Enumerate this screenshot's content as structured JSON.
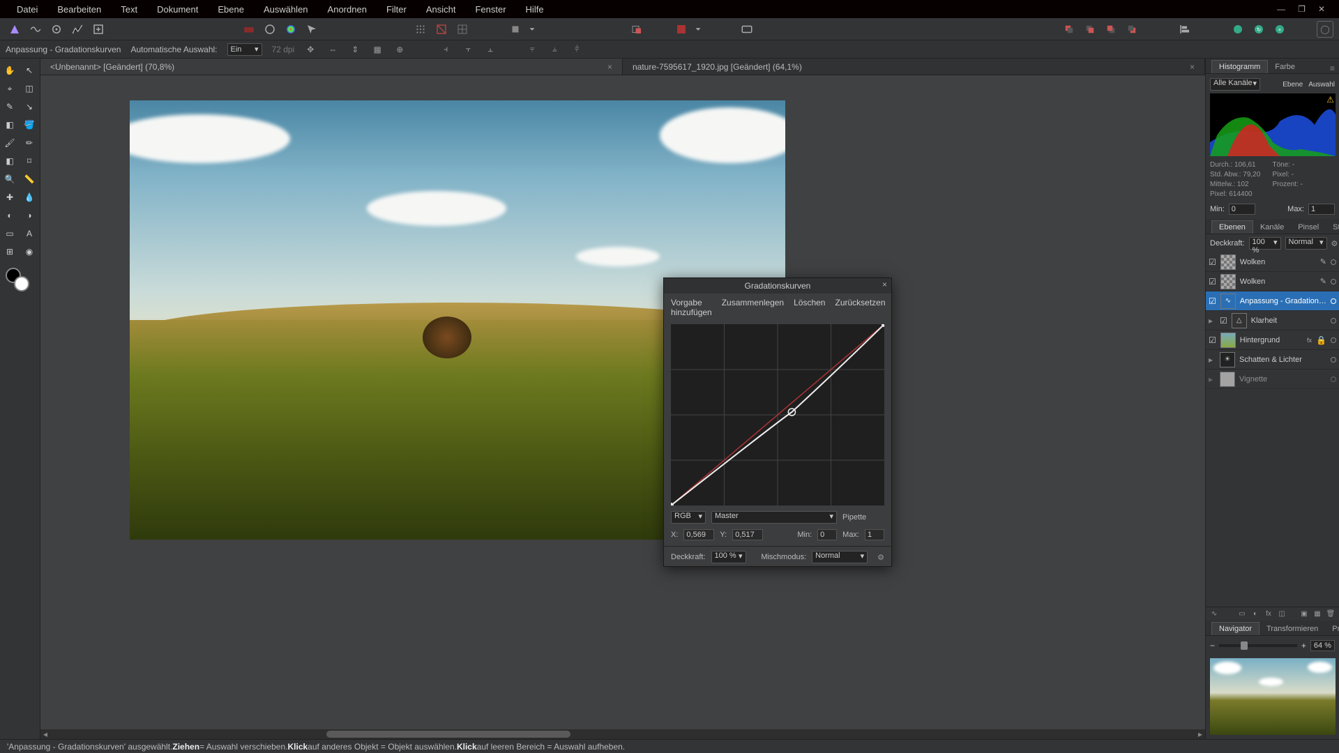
{
  "menu": [
    "Datei",
    "Bearbeiten",
    "Text",
    "Dokument",
    "Ebene",
    "Auswählen",
    "Anordnen",
    "Filter",
    "Ansicht",
    "Fenster",
    "Hilfe"
  ],
  "context": {
    "title": "Anpassung - Gradationskurven",
    "auto_label": "Automatische Auswahl:",
    "auto_value": "Ein",
    "dpi": "72 dpi"
  },
  "tabs": [
    {
      "label": "<Unbenannt> [Geändert] (70,8%)",
      "active": true
    },
    {
      "label": "nature-7595617_1920.jpg [Geändert] (64,1%)",
      "active": false
    }
  ],
  "histogram": {
    "tabs": [
      "Histogramm",
      "Farbe"
    ],
    "channel": "Alle Kanäle",
    "btn1": "Ebene",
    "btn2": "Auswahl",
    "stats": {
      "durch": "Durch.: 106,61",
      "tone": "Töne: -",
      "std": "Std. Abw.: 79,20",
      "pixel_s": "Pixel: -",
      "mittel": "Mittelw.: 102",
      "prozent": "Prozent: -",
      "pixel": "Pixel: 614400"
    },
    "min_label": "Min:",
    "min": "0",
    "max_label": "Max:",
    "max": "1"
  },
  "layers": {
    "tabs": [
      "Ebenen",
      "Kanäle",
      "Pinsel",
      "Stock"
    ],
    "opacity_label": "Deckkraft:",
    "opacity": "100 %",
    "blend": "Normal",
    "items": [
      {
        "name": "Wolken",
        "type": "mask"
      },
      {
        "name": "Wolken",
        "type": "mask"
      },
      {
        "name": "Anpassung - Gradations..",
        "type": "adjust",
        "selected": true
      },
      {
        "name": "Klarheit",
        "type": "adjust_tri"
      },
      {
        "name": "Hintergrund",
        "type": "img",
        "fx": true,
        "lock": true
      },
      {
        "name": "Schatten & Lichter",
        "type": "adjust_sun"
      },
      {
        "name": "Vignette",
        "type": "adjust"
      }
    ]
  },
  "navigator": {
    "tabs": [
      "Navigator",
      "Transformieren",
      "Protokoll"
    ],
    "zoom": "64 %"
  },
  "curves": {
    "title": "Gradationskurven",
    "add_preset": "Vorgabe hinzufügen",
    "merge": "Zusammenlegen",
    "delete": "Löschen",
    "reset": "Zurücksetzen",
    "channel": "RGB",
    "master": "Master",
    "pipette": "Pipette",
    "x_label": "X:",
    "x": "0,569",
    "y_label": "Y:",
    "y": "0,517",
    "min_label": "Min:",
    "min": "0",
    "max_label": "Max:",
    "max": "1",
    "opacity_label": "Deckkraft:",
    "opacity": "100 %",
    "blend_label": "Mischmodus:",
    "blend": "Normal"
  },
  "status": {
    "pre": "'Anpassung - Gradationskurven' ausgewählt. ",
    "b1": "Ziehen",
    "t1": " = Auswahl verschieben. ",
    "b2": "Klick",
    "t2": " auf anderes Objekt = Objekt auswählen. ",
    "b3": "Klick",
    "t3": " auf leeren Bereich = Auswahl aufheben."
  }
}
